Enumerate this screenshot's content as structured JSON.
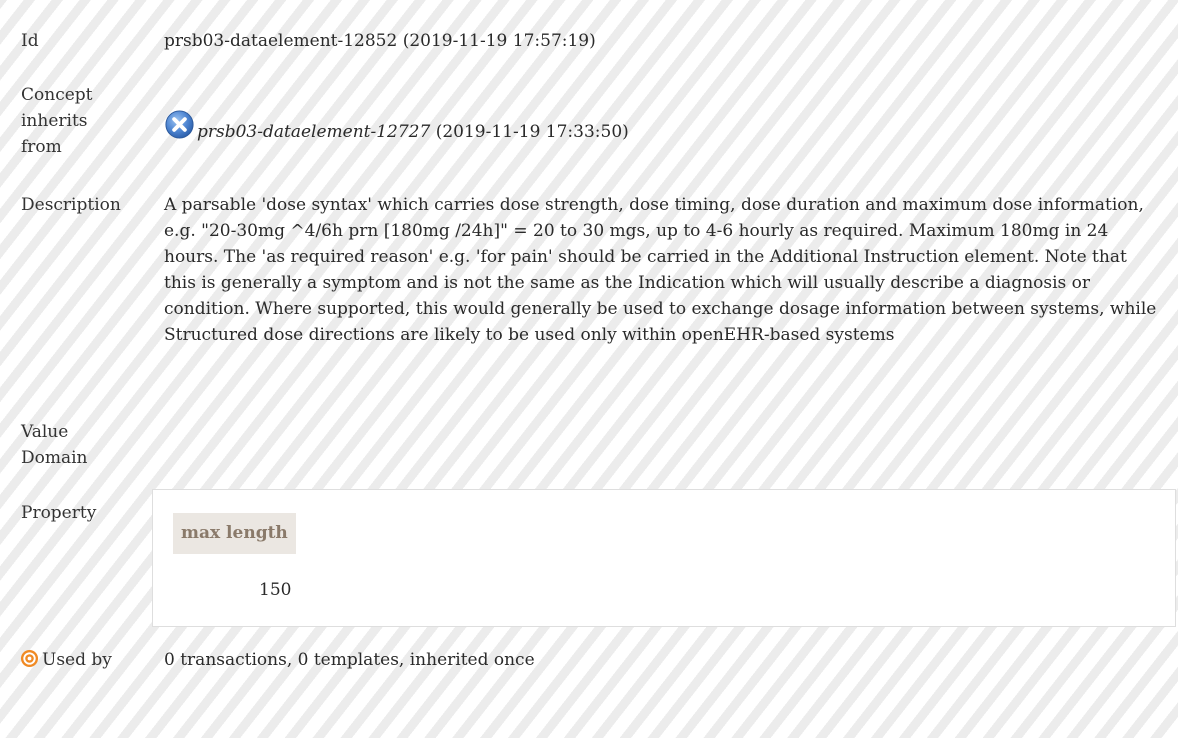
{
  "rows": {
    "id": {
      "label": "Id",
      "value": "prsb03-dataelement-12852 (2019-11-19 17:57:19)"
    },
    "concept_inherits": {
      "label": "Concept inherits from",
      "ref_id": "prsb03-dataelement-12727",
      "ref_date": " (2019-11-19 17:33:50)",
      "icon": "remove-circle-icon"
    },
    "description": {
      "label": "Description",
      "value": "A parsable 'dose syntax' which carries dose strength, dose timing, dose duration and maximum dose information, e.g. \"20-30mg ^4/6h prn [180mg /24h]\" = 20 to 30 mgs, up to 4-6 hourly as required. Maximum 180mg in 24 hours. The 'as required reason' e.g. 'for pain' should be carried in the Additional Instruction element. Note that this is generally a symptom and is not the same as the Indication which will usually describe a diagnosis or condition. Where supported, this would generally be used to exchange dosage information between systems, while Structured dose directions are likely to be used only within openEHR-based systems"
    },
    "value_domain": {
      "label": "Value Domain"
    },
    "property": {
      "label": "Property",
      "header": "max length",
      "value": "150"
    },
    "used_by": {
      "label": "Used by",
      "value": "0 transactions, 0 templates, inherited once",
      "icon": "target-icon"
    }
  },
  "colors": {
    "icon_blue": "#5a8fd6",
    "target_orange": "#f08a24",
    "header_bg": "#ebe7e2",
    "header_text": "#8a7a6a"
  }
}
